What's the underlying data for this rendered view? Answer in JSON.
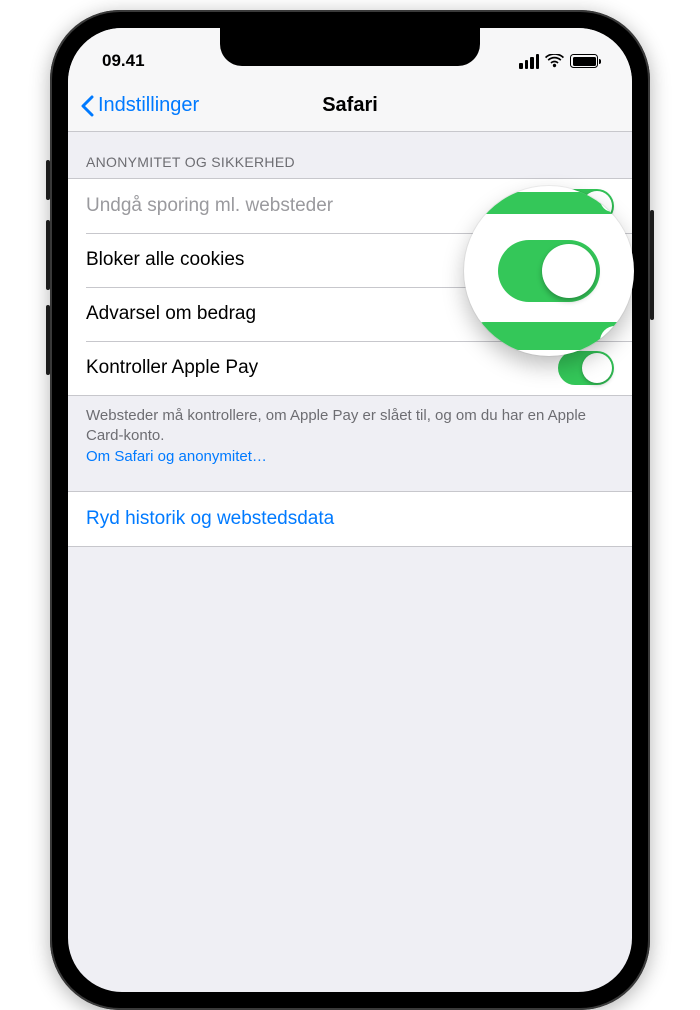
{
  "status": {
    "time": "09.41"
  },
  "nav": {
    "back_label": "Indstillinger",
    "title": "Safari"
  },
  "section": {
    "header": "ANONYMITET OG SIKKERHED"
  },
  "rows": {
    "prevent_tracking": {
      "label": "Undgå sporing ml. websteder",
      "on": true
    },
    "block_cookies": {
      "label": "Bloker alle cookies",
      "on": true
    },
    "fraud_warning": {
      "label": "Advarsel om bedrag",
      "on": true
    },
    "apple_pay": {
      "label": "Kontroller Apple Pay",
      "on": true
    }
  },
  "footer": {
    "text": "Websteder må kontrollere, om Apple Pay er slået til, og om du har en Apple Card-konto.",
    "link": "Om Safari og anonymitet…"
  },
  "clear": {
    "label": "Ryd historik og webstedsdata"
  }
}
